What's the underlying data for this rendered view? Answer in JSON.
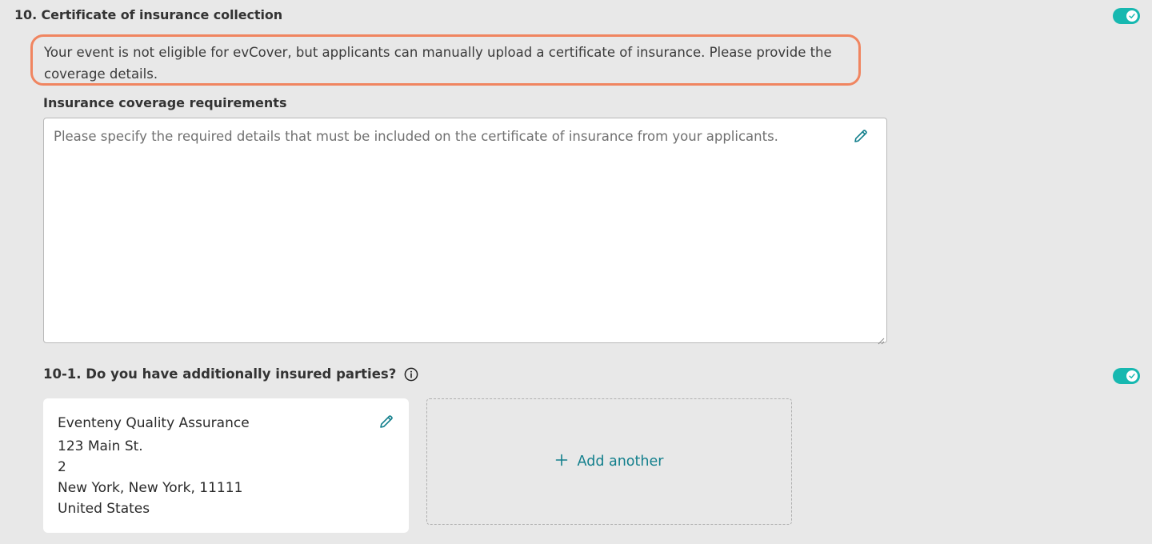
{
  "section": {
    "title": "10. Certificate of insurance collection",
    "toggle_on": true
  },
  "notice": {
    "text": "Your event is not eligible for evCover, but applicants can manually upload a certificate of insurance. Please provide the coverage details."
  },
  "coverage": {
    "label": "Insurance coverage requirements",
    "placeholder": "Please specify the required details that must be included on the certificate of insurance from your applicants.",
    "value": ""
  },
  "additional": {
    "title": "10-1. Do you have additionally insured parties?",
    "toggle_on": true,
    "parties": [
      {
        "name": "Eventeny Quality Assurance",
        "street": "123 Main St.",
        "unit": "2",
        "city_line": "New York, New York, 11111",
        "country": "United States"
      }
    ],
    "add_label": "Add another"
  },
  "colors": {
    "accent": "#17b8b0",
    "link": "#127f8c",
    "highlight_border": "#f08560",
    "background": "#e8e8e8"
  },
  "icons": [
    "check-icon",
    "pencil-icon",
    "info-icon",
    "plus-icon",
    "resize-grip-icon"
  ]
}
